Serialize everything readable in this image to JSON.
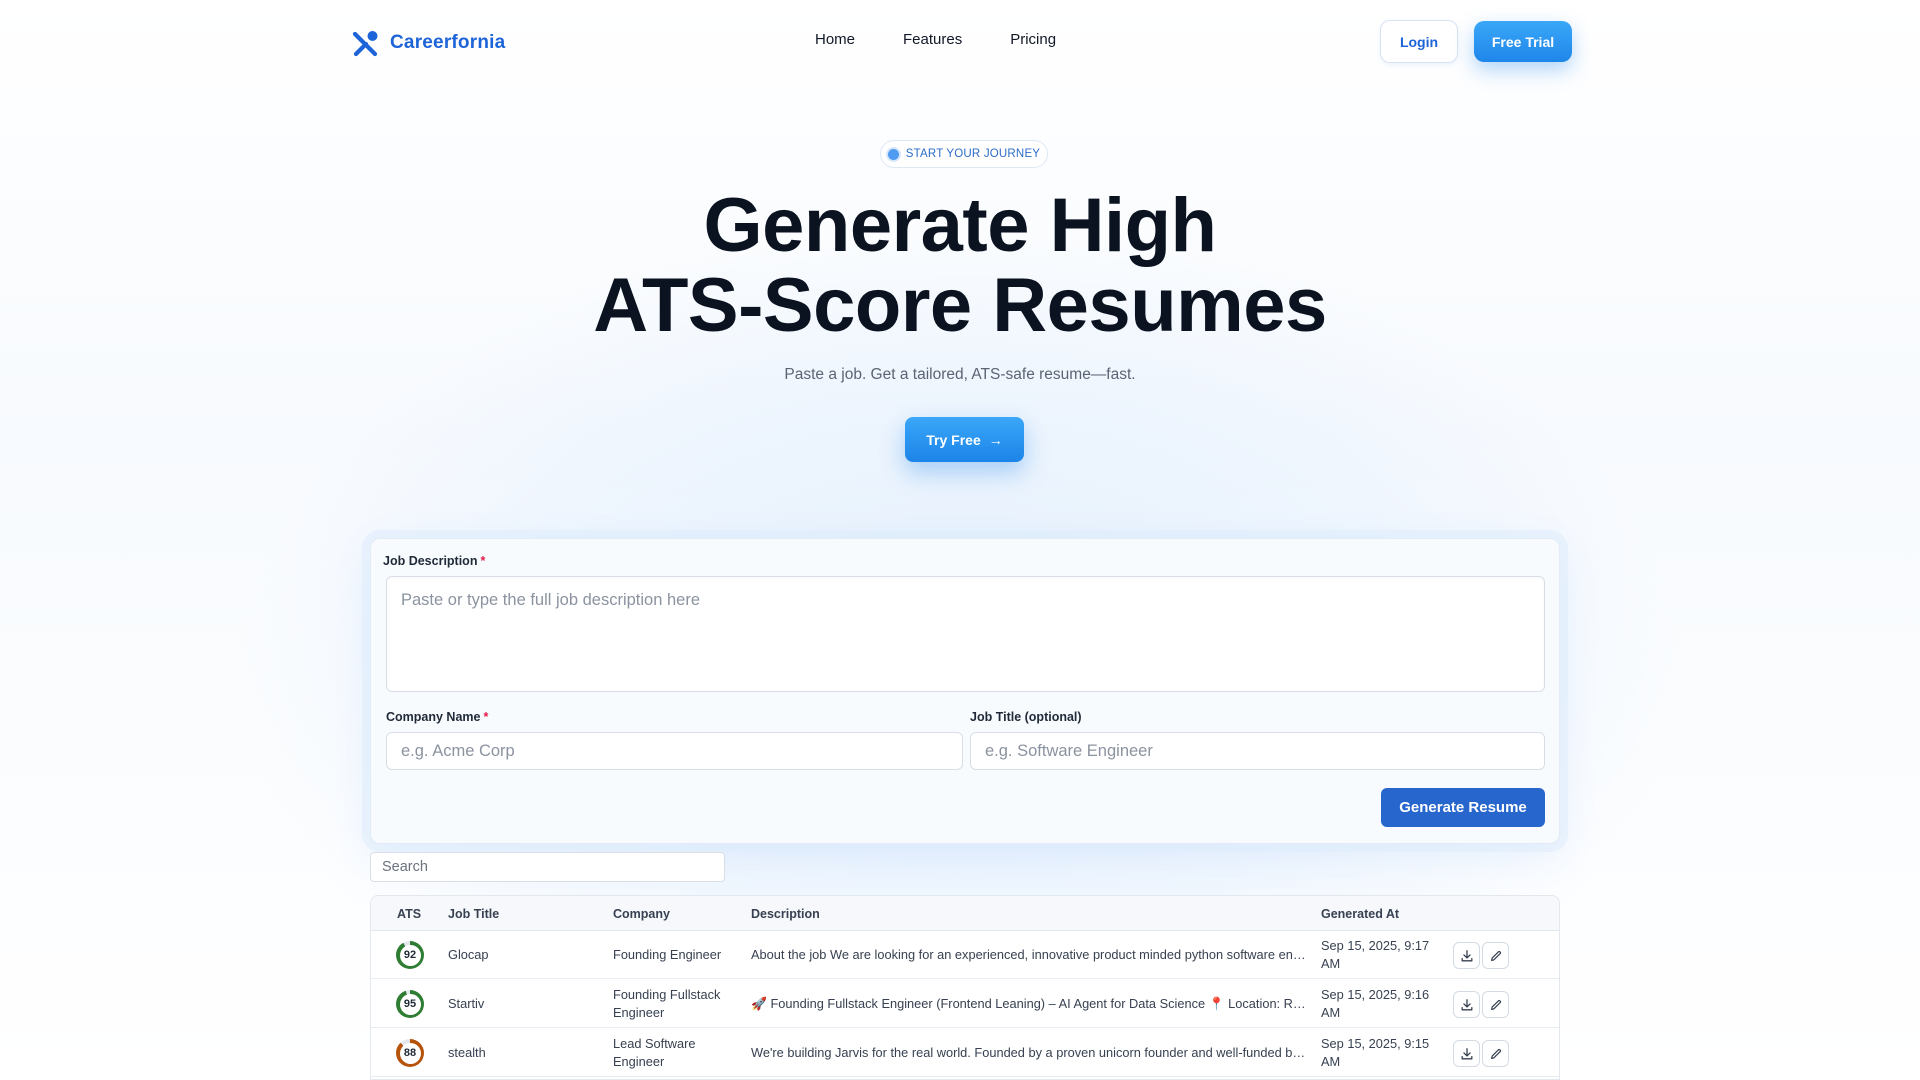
{
  "brand": {
    "name": "Careerfornia"
  },
  "nav": {
    "links": [
      "Home",
      "Features",
      "Pricing"
    ],
    "login_label": "Login",
    "trial_label": "Free Trial"
  },
  "hero": {
    "badge": "START YOUR JOURNEY",
    "title_line1": "Generate High",
    "title_line2": "ATS-Score Resumes",
    "subtitle": "Paste a job. Get a tailored, ATS-safe resume—fast.",
    "cta_label": "Try Free",
    "cta_arrow": "→"
  },
  "form": {
    "job_description": {
      "label": "Job Description",
      "required_mark": "*",
      "placeholder": "Paste or type the full job description here"
    },
    "company_name": {
      "label": "Company Name",
      "required_mark": "*",
      "placeholder": "e.g. Acme Corp"
    },
    "job_title": {
      "label": "Job Title (optional)",
      "placeholder": "e.g. Software Engineer"
    },
    "submit_label": "Generate Resume"
  },
  "search": {
    "placeholder": "Search"
  },
  "table": {
    "columns": [
      "ATS",
      "Job Title",
      "Company",
      "Description",
      "Generated At"
    ],
    "rows": [
      {
        "ats": 92,
        "job_title": "Glocap",
        "company_line1": "Founding Engineer",
        "company_line2": "",
        "description": "About the job We are looking for an experienced, innovative product minded python software engineer to join our founding team",
        "generated_line1": "Sep 15, 2025, 9:17",
        "generated_line2": "AM"
      },
      {
        "ats": 95,
        "job_title": "Startiv",
        "company_line1": "Founding Fullstack",
        "company_line2": "Engineer",
        "description": "🚀 Founding Fullstack Engineer (Frontend Leaning) – AI Agent for Data Science 📍 Location: Remote",
        "generated_line1": "Sep 15, 2025, 9:16",
        "generated_line2": "AM"
      },
      {
        "ats": 88,
        "job_title": "stealth",
        "company_line1": "Lead Software",
        "company_line2": "Engineer",
        "description": "We're building Jarvis for the real world. Founded by a proven unicorn founder and well-funded by top investors",
        "generated_line1": "Sep 15, 2025, 9:15",
        "generated_line2": "AM"
      }
    ],
    "row_actions": [
      "download-icon",
      "edit-pencil-icon"
    ]
  },
  "colors": {
    "brand_blue": "#1d64d8",
    "accent_sky": "#2f9bf4",
    "generate_button": "#2766cc",
    "ats_good": "#2e7d32",
    "ats_warn": "#b45309"
  }
}
